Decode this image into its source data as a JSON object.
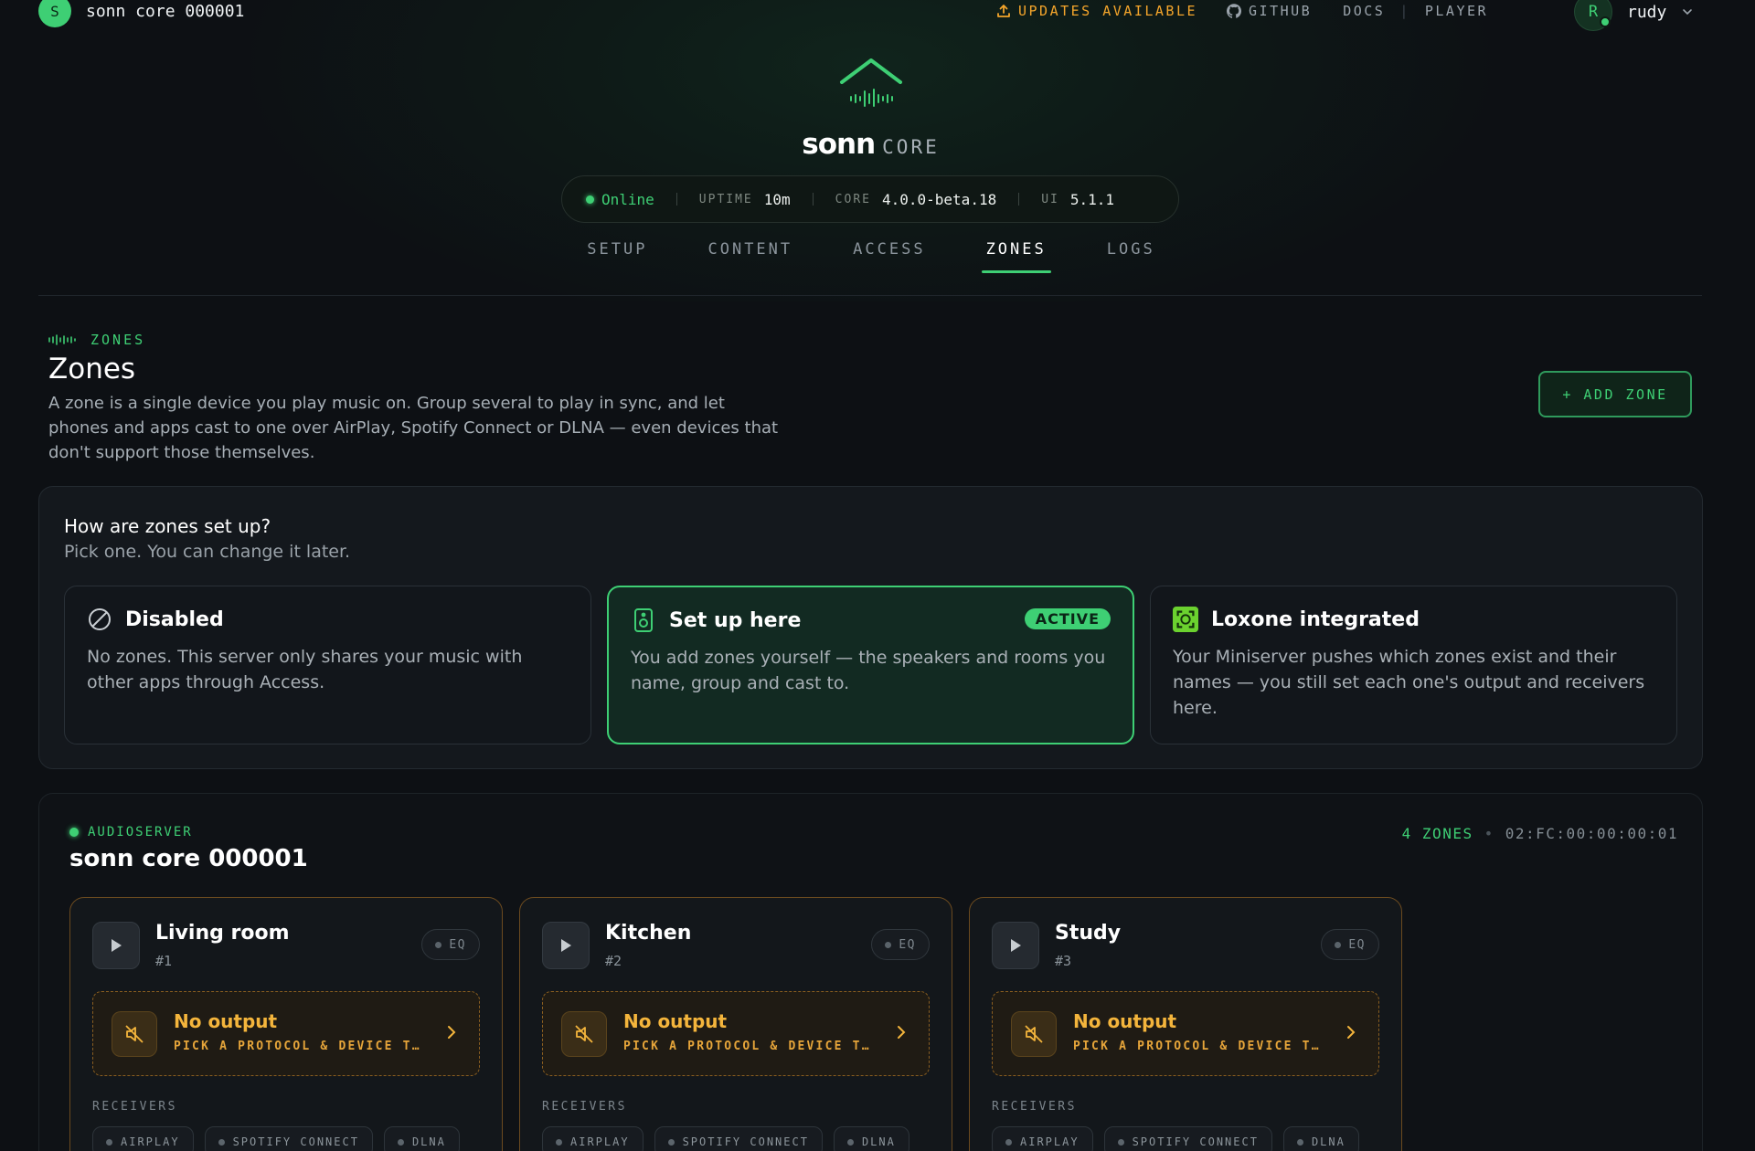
{
  "topbar": {
    "avatar_letter": "S",
    "server_name": "sonn core 000001",
    "updates_label": "UPDATES AVAILABLE",
    "github_label": "GITHUB",
    "docs_label": "DOCS",
    "player_label": "PLAYER",
    "user_initial": "R",
    "user_name": "rudy"
  },
  "hero": {
    "product": "sonn",
    "product_suffix": "CORE",
    "status": "Online",
    "uptime_label": "UPTIME",
    "uptime_value": "10m",
    "core_label": "CORE",
    "core_value": "4.0.0-beta.18",
    "ui_label": "UI",
    "ui_value": "5.1.1"
  },
  "tabs": [
    {
      "label": "SETUP"
    },
    {
      "label": "CONTENT"
    },
    {
      "label": "ACCESS"
    },
    {
      "label": "ZONES",
      "active": true
    },
    {
      "label": "LOGS"
    }
  ],
  "section": {
    "eyebrow": "ZONES",
    "title": "Zones",
    "description": "A zone is a single device you play music on. Group several to play in sync, and let phones and apps cast to one over AirPlay, Spotify Connect or DLNA — even devices that don't support those themselves.",
    "add_button": "+ ADD ZONE"
  },
  "mode": {
    "title": "How are zones set up?",
    "subtitle": "Pick one. You can change it later.",
    "options": [
      {
        "title": "Disabled",
        "desc": "No zones. This server only shares your music with other apps through Access.",
        "icon": "disabled-icon"
      },
      {
        "title": "Set up here",
        "desc": "You add zones yourself — the speakers and rooms you name, group and cast to.",
        "icon": "speaker-icon",
        "badge": "ACTIVE"
      },
      {
        "title": "Loxone integrated",
        "desc": "Your Miniserver pushes which zones exist and their names — you still set each one's output and receivers here.",
        "icon": "loxone-icon"
      }
    ]
  },
  "server": {
    "eyebrow": "AUDIOSERVER",
    "name": "sonn core 000001",
    "zone_count": "4 ZONES",
    "mac": "02:FC:00:00:00:01",
    "receivers_label": "RECEIVERS",
    "zones": [
      {
        "name": "Living room",
        "number": "#1",
        "eq": "EQ",
        "output_title": "No output",
        "output_sub": "PICK A PROTOCOL & DEVICE T…",
        "receivers": [
          "AIRPLAY",
          "SPOTIFY CONNECT",
          "DLNA"
        ]
      },
      {
        "name": "Kitchen",
        "number": "#2",
        "eq": "EQ",
        "output_title": "No output",
        "output_sub": "PICK A PROTOCOL & DEVICE T…",
        "receivers": [
          "AIRPLAY",
          "SPOTIFY CONNECT",
          "DLNA"
        ]
      },
      {
        "name": "Study",
        "number": "#3",
        "eq": "EQ",
        "output_title": "No output",
        "output_sub": "PICK A PROTOCOL & DEVICE T…",
        "receivers": [
          "AIRPLAY",
          "SPOTIFY CONNECT",
          "DLNA"
        ]
      }
    ]
  },
  "colors": {
    "accent": "#3ecf74",
    "warning": "#f4b53c",
    "background": "#0d1014"
  }
}
